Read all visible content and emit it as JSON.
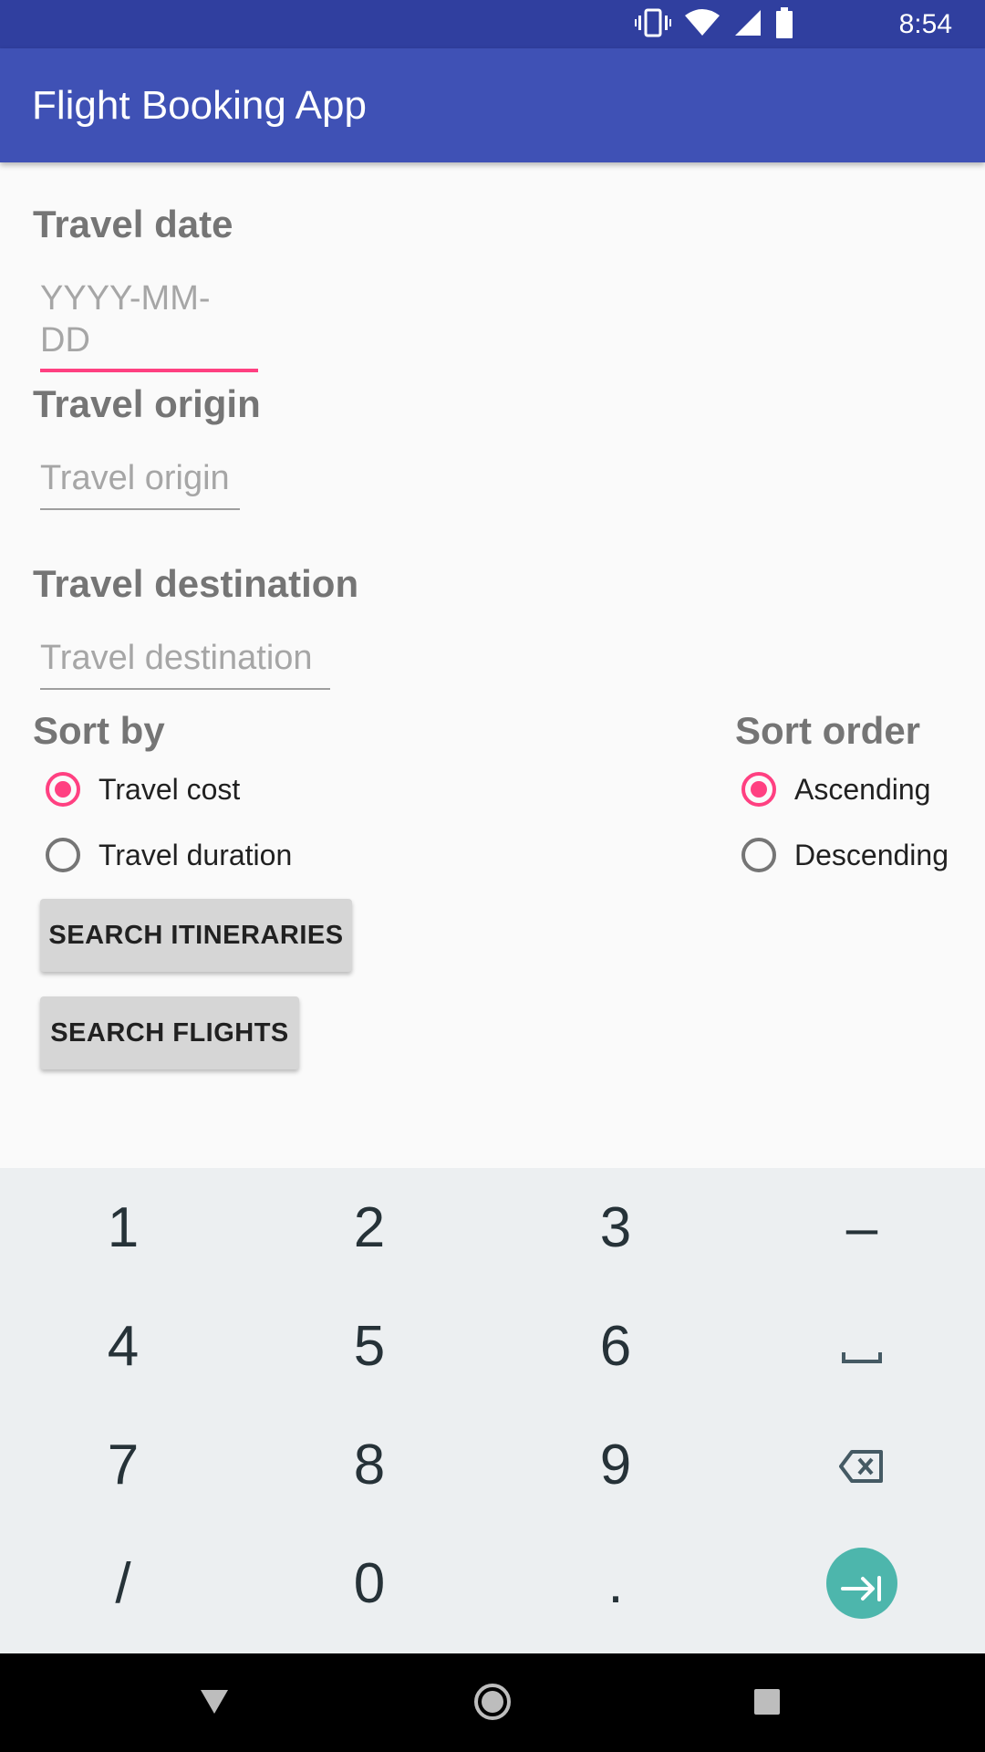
{
  "status_bar": {
    "time": "8:54",
    "icons": [
      "vibrate-icon",
      "wifi-icon",
      "signal-icon",
      "battery-icon"
    ]
  },
  "app_bar": {
    "title": "Flight Booking App"
  },
  "form": {
    "travel_date": {
      "label": "Travel date",
      "placeholder": "YYYY-MM-DD",
      "value": ""
    },
    "travel_origin": {
      "label": "Travel origin",
      "placeholder": "Travel origin",
      "value": ""
    },
    "travel_destination": {
      "label": "Travel destination",
      "placeholder": "Travel destination",
      "value": ""
    },
    "sort_by": {
      "label": "Sort by",
      "options": [
        {
          "label": "Travel cost",
          "checked": true
        },
        {
          "label": "Travel duration",
          "checked": false
        }
      ]
    },
    "sort_order": {
      "label": "Sort order",
      "options": [
        {
          "label": "Ascending",
          "checked": true
        },
        {
          "label": "Descending",
          "checked": false
        }
      ]
    },
    "buttons": {
      "search_itineraries": "SEARCH ITINERARIES",
      "search_flights": "SEARCH FLIGHTS"
    }
  },
  "keyboard": {
    "rows": [
      [
        "1",
        "2",
        "3",
        "–"
      ],
      [
        "4",
        "5",
        "6",
        "space"
      ],
      [
        "7",
        "8",
        "9",
        "backspace"
      ],
      [
        "/",
        "0",
        ".",
        "next"
      ]
    ]
  },
  "colors": {
    "status_bar": "#303f9f",
    "app_bar": "#3f51b5",
    "accent": "#ff4081",
    "enter_key": "#4db6ac"
  }
}
